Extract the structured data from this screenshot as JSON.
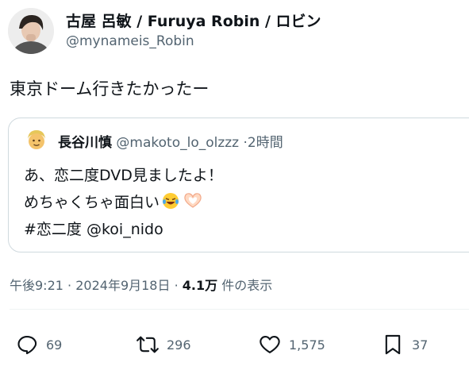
{
  "author": {
    "display_name": "古屋 呂敏 / Furuya Robin / ロビン",
    "handle": "@mynameis_Robin"
  },
  "post": {
    "text": "東京ドーム行きたかったー"
  },
  "quoted_post": {
    "display_name": "長谷川慎",
    "handle": "@makoto_lo_olzzz",
    "separator": "·",
    "time": "2時間",
    "line1": "あ、恋二度DVD見ましたよ！",
    "line2": "めちゃくちゃ面白い",
    "line3": "#恋二度 @koi_nido"
  },
  "meta": {
    "time": "午後9:21",
    "sep1": "·",
    "date": "2024年9月18日",
    "sep2": "·",
    "views_count": "4.1万",
    "views_label": "件の表示"
  },
  "actions": {
    "replies": "69",
    "reposts": "296",
    "likes": "1,575",
    "bookmarks": "37"
  },
  "colors": {
    "text": "#0f1419",
    "secondary": "#536471",
    "border": "#cfd9de"
  },
  "icons": [
    "reply-icon",
    "repost-icon",
    "like-icon",
    "bookmark-icon",
    "laughing-emoji-icon",
    "heart-hands-emoji-icon"
  ]
}
